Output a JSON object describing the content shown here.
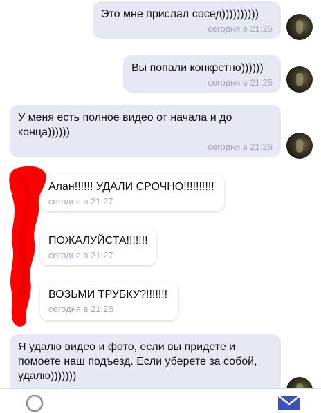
{
  "messages": [
    {
      "text": "Это мне прислал сосед))))))))))",
      "time": "сегодня в 21:25",
      "side": "out"
    },
    {
      "text": "Вы попали конкретно))))))",
      "time": "сегодня в 21:25",
      "side": "out"
    },
    {
      "text": "У меня есть полное видео от начала и до\nконца))))))",
      "time": "сегодня в 21:26",
      "side": "out"
    },
    {
      "text": "Алан!!!!!! УДАЛИ СРОЧНО!!!!!!!!!!",
      "time": "сегодня в 21:27",
      "side": "in"
    },
    {
      "text": "ПОЖАЛУЙСТА!!!!!!!",
      "time": "сегодня в 21:27",
      "side": "in"
    },
    {
      "text": "ВОЗЬМИ ТРУБКУ?!!!!!!!",
      "time": "сегодня в 21:28",
      "side": "in"
    },
    {
      "text": "Я удалю видео и фото, если вы придете и\nпомоете наш подъезд. Если уберете за собой,\nудалю)))))))",
      "time": "",
      "side": "out"
    }
  ],
  "colors": {
    "outgoing_bubble": "#e6e8f4",
    "incoming_bubble": "#ffffff",
    "timestamp": "#a4a9bd",
    "redaction": "#ff0000",
    "send_icon": "#3f51b5"
  },
  "icons": {
    "avatar": "contact-avatar",
    "emoji": "emoji-icon",
    "send": "send-icon"
  }
}
